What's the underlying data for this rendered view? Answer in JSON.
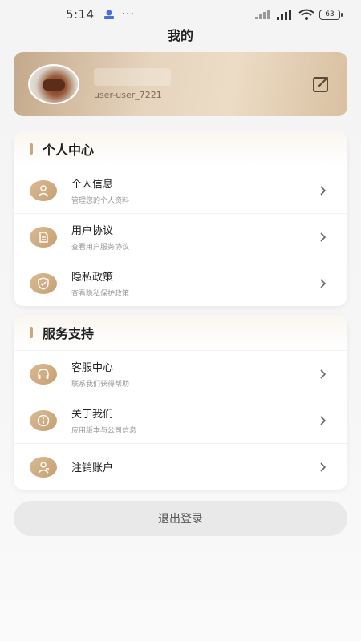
{
  "status_bar": {
    "time": "5:14",
    "dots": "···",
    "battery": "63"
  },
  "page": {
    "title": "我的"
  },
  "profile": {
    "username": "user-user_7221"
  },
  "sections": [
    {
      "title": "个人中心",
      "items": [
        {
          "icon": "user-icon",
          "title": "个人信息",
          "subtitle": "管理您的个人资料"
        },
        {
          "icon": "document-icon",
          "title": "用户协议",
          "subtitle": "查看用户服务协议"
        },
        {
          "icon": "shield-icon",
          "title": "隐私政策",
          "subtitle": "查看隐私保护政策"
        }
      ]
    },
    {
      "title": "服务支持",
      "items": [
        {
          "icon": "headset-icon",
          "title": "客服中心",
          "subtitle": "联系我们获得帮助"
        },
        {
          "icon": "info-icon",
          "title": "关于我们",
          "subtitle": "应用版本与公司信息"
        },
        {
          "icon": "user-remove-icon",
          "title": "注销账户",
          "subtitle": ""
        }
      ]
    }
  ],
  "logout_label": "退出登录",
  "colors": {
    "accent": "#c9a87e",
    "icon_bg": "#d2b086",
    "logout_bg": "#e9e9e9"
  }
}
